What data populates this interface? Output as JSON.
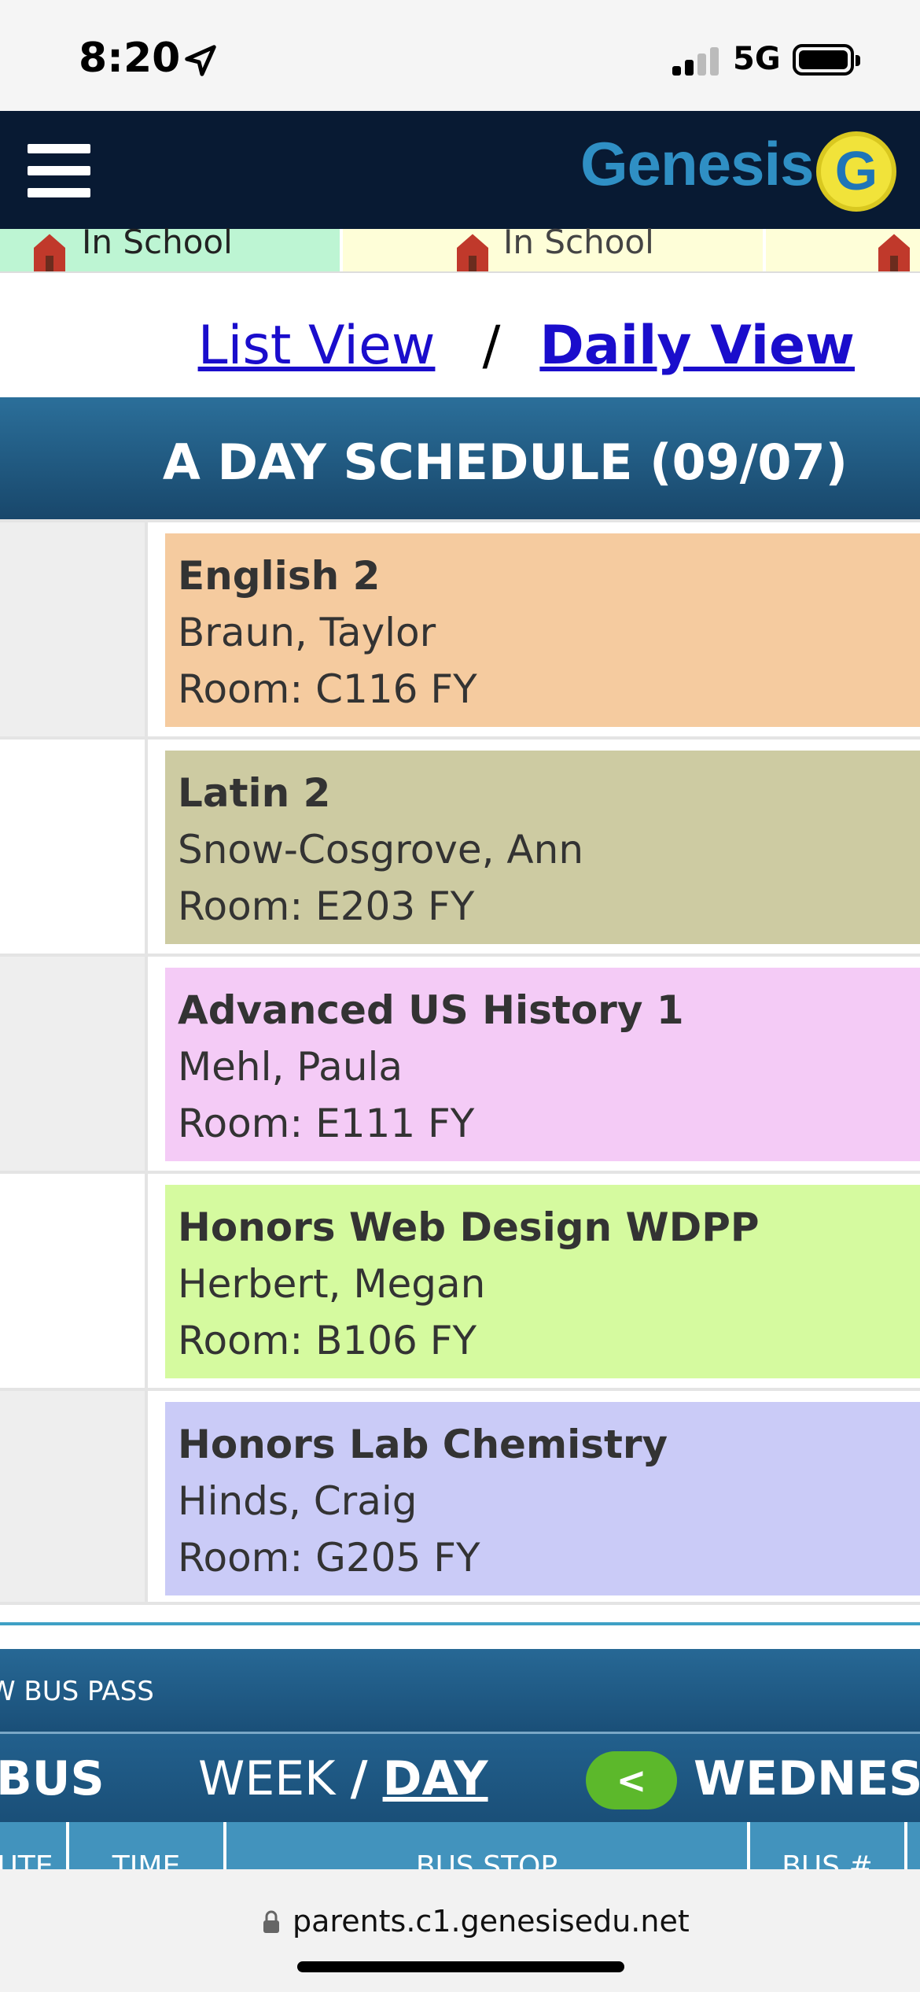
{
  "status_bar": {
    "time": "8:20",
    "network": "5G",
    "icons": [
      "location-arrow-icon",
      "signal-icon",
      "battery-icon"
    ]
  },
  "header": {
    "brand": "Genesis",
    "logo_letter": "G",
    "menu_icon": "hamburger-menu-icon"
  },
  "attendance": [
    {
      "label": "In School",
      "color": "#bdf5d3"
    },
    {
      "label": "In School",
      "color": "#fefed8"
    },
    {
      "label": "",
      "color": "#fefed8"
    }
  ],
  "view_switch": {
    "list_view": "List View",
    "separator": "/",
    "daily_view": "Daily View"
  },
  "schedule": {
    "title": "A DAY SCHEDULE (09/07)",
    "rows": [
      {
        "name": "English 2",
        "teacher": "Braun, Taylor",
        "room": "Room: C116 FY",
        "color": "#f5cb9f",
        "left_bg": "#eeeeee"
      },
      {
        "name": "Latin 2",
        "teacher": "Snow-Cosgrove, Ann",
        "room": "Room: E203 FY",
        "color": "#cdcba2",
        "left_bg": "#ffffff"
      },
      {
        "name": "Advanced US History 1",
        "teacher": "Mehl, Paula",
        "room": "Room: E111 FY",
        "color": "#f4cbf6",
        "left_bg": "#eeeeee"
      },
      {
        "name": "Honors Web Design WDPP",
        "teacher": "Herbert, Megan",
        "room": "Room: B106 FY",
        "color": "#d5fa9f",
        "left_bg": "#ffffff"
      },
      {
        "name": "Honors Lab Chemistry",
        "teacher": "Hinds, Craig",
        "room": "Room: G205 FY",
        "color": "#cacbf7",
        "left_bg": "#eeeeee"
      }
    ]
  },
  "bus": {
    "pass_label": "W BUS PASS",
    "title": "BUS",
    "week": "WEEK",
    "slash": "/",
    "day": "DAY",
    "prev": "<",
    "day_label": "WEDNESD",
    "columns": [
      "UTE",
      "TIME",
      "BUS STOP",
      "BUS #"
    ]
  },
  "browser": {
    "url": "parents.c1.genesisedu.net"
  }
}
